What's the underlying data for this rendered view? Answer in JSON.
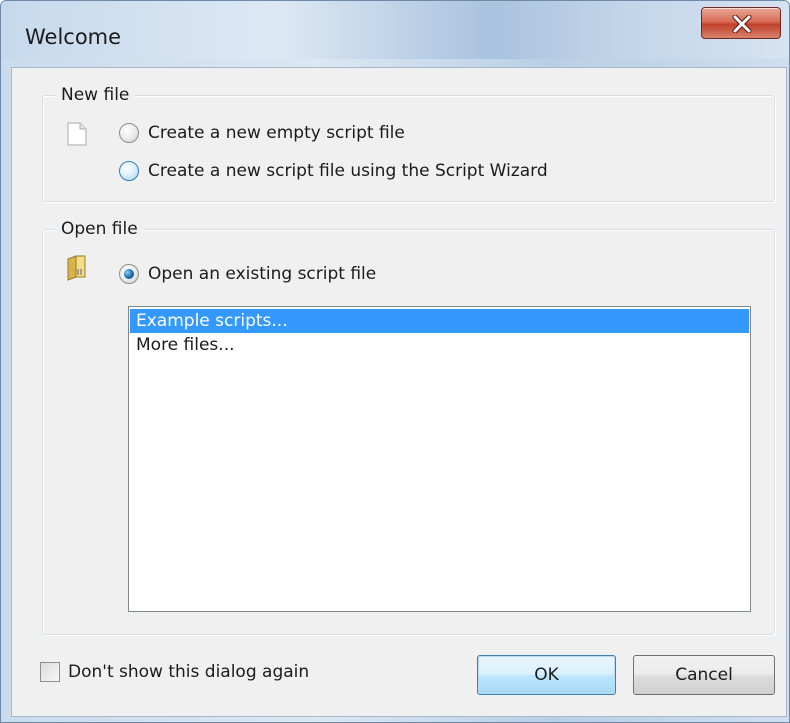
{
  "window": {
    "title": "Welcome",
    "close_icon": "close-icon"
  },
  "new_file_group": {
    "legend": "New file",
    "icon": "blank-document-icon",
    "options": [
      {
        "label": "Create a new empty script file",
        "checked": false
      },
      {
        "label": "Create a new script file using the Script Wizard",
        "checked": false
      }
    ]
  },
  "open_file_group": {
    "legend": "Open file",
    "icon": "folder-document-icon",
    "option": {
      "label": "Open an existing script file",
      "checked": true
    },
    "list_items": [
      "Example scripts...",
      "More files..."
    ],
    "selected_index": 0
  },
  "footer": {
    "checkbox_label": "Don't show this dialog again",
    "checkbox_checked": false,
    "ok_label": "OK",
    "cancel_label": "Cancel"
  },
  "colors": {
    "selection": "#3399ff",
    "close_button": "#c8462f"
  }
}
